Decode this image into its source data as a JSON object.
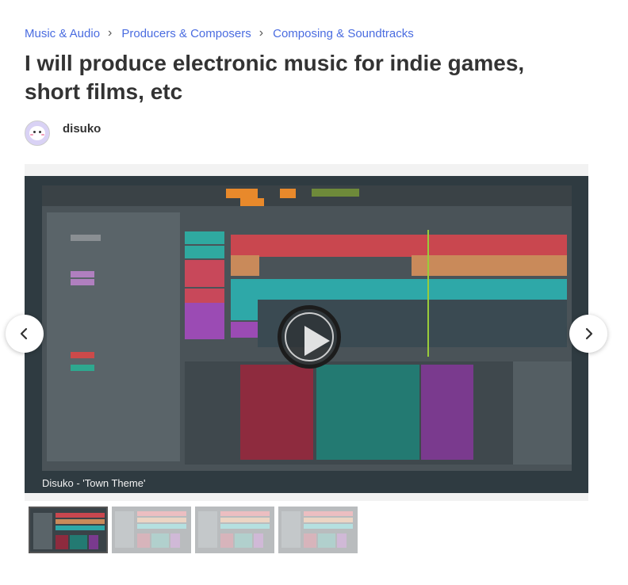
{
  "breadcrumb": {
    "items": [
      "Music & Audio",
      "Producers & Composers",
      "Composing & Soundtracks"
    ]
  },
  "gig": {
    "title": "I will produce electronic music for indie games, short films, etc"
  },
  "seller": {
    "name": "disuko"
  },
  "video": {
    "caption": "Disuko - 'Town Theme'"
  },
  "icons": {
    "prev": "chevron-left-icon",
    "next": "chevron-right-icon",
    "play": "play-icon",
    "separator": "chevron-right-icon"
  },
  "colors": {
    "link": "#4a6ce0",
    "title": "#333333",
    "video_bg": "#2f3b41"
  }
}
